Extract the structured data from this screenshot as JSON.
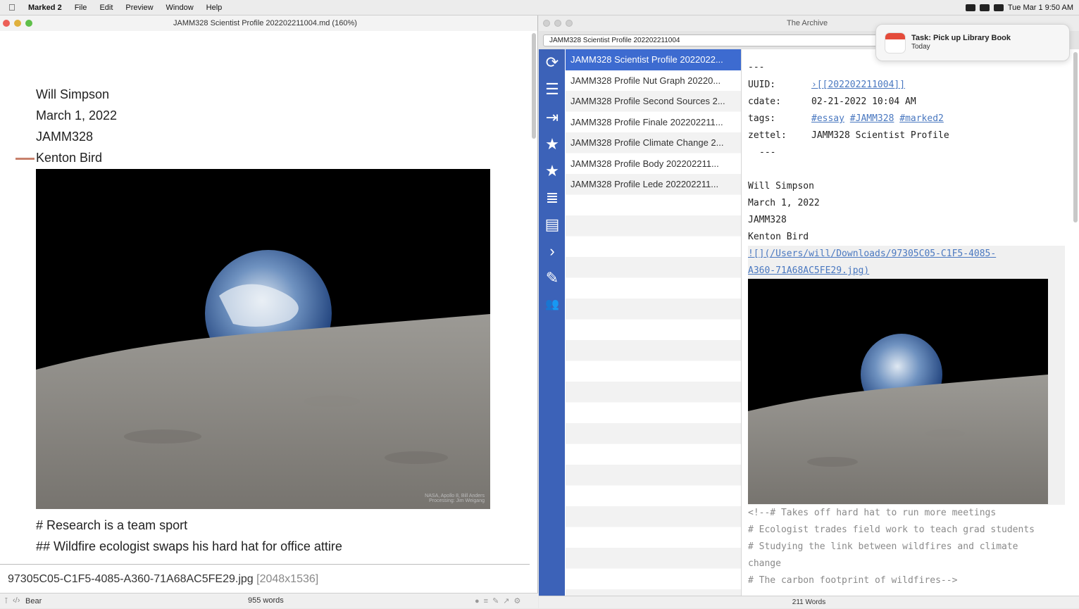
{
  "menubar": {
    "app": "Marked 2",
    "menus": [
      "File",
      "Edit",
      "Preview",
      "Window",
      "Help"
    ],
    "clock": "Tue Mar 1  9:50 AM"
  },
  "left_window": {
    "title": "JAMM328 Scientist Profile 202202211004.md (160%)",
    "lines": [
      "Will Simpson",
      "March 1, 2022",
      "JAMM328",
      "Kenton Bird"
    ],
    "photo_credit": [
      "NASA, Apollo 8, Bill Anders",
      "Processing: Jim Weigang"
    ],
    "heading1": "# Research is a team sport",
    "heading2": "## Wildfire ecologist swaps his hard hat for office attire",
    "footer_filename": "97305C05-C1F5-4085-A360-71A68AC5FE29.jpg",
    "footer_dims": "[2048x1536]",
    "status_app": "Bear",
    "status_words": "955 words"
  },
  "right_window": {
    "title": "The Archive",
    "search_value": "JAMM328 Scientist Profile 202202211004",
    "notes": [
      "JAMM328 Scientist Profile 2022022...",
      "JAMM328 Profile Nut Graph 20220...",
      "JAMM328 Profile Second Sources 2...",
      "JAMM328 Profile Finale 202202211...",
      "JAMM328 Profile Climate Change 2...",
      "JAMM328 Profile Body 202202211...",
      "JAMM328 Profile Lede 202202211..."
    ],
    "editor": {
      "sep": "---",
      "uuid_key": "UUID:",
      "uuid_val": "›[[202202211004]]",
      "cdate_key": "cdate:",
      "cdate_val": "02-21-2022 10:04 AM",
      "tags_key": "tags:",
      "tags": [
        "#essay",
        "#JAMM328",
        "#marked2"
      ],
      "zettel_key": "zettel:",
      "zettel_val": "JAMM328 Scientist Profile",
      "sep2": "---",
      "lines": [
        "Will Simpson",
        "March 1, 2022",
        "JAMM328",
        "Kenton Bird"
      ],
      "img_link_1": "![](/Users/will/Downloads/97305C05-C1F5-4085-",
      "img_link_2": "A360-71A68AC5FE29.jpg)",
      "comments": [
        "<!--# Takes off hard hat to run more meetings",
        "# Ecologist trades field work to teach grad students",
        "# Studying the link between wildfires and climate",
        "change",
        "# The carbon footprint of wildfires-->"
      ]
    },
    "status_words": "211 Words"
  },
  "notification": {
    "title": "Task: Pick up Library Book",
    "subtitle": "Today"
  }
}
